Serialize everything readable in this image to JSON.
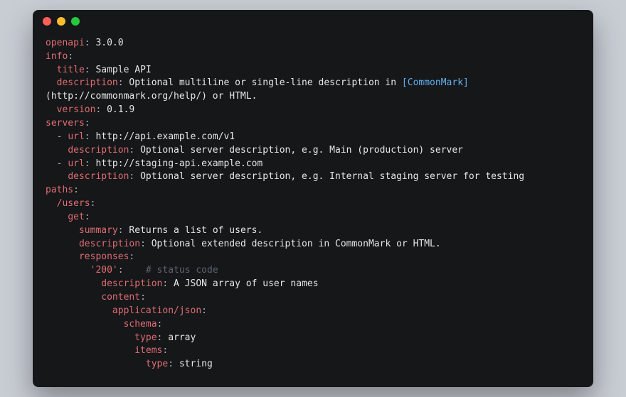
{
  "colors": {
    "bg_page": "#c8cdd4",
    "bg_window": "#151718",
    "key": "#e06c75",
    "value": "#e6e6e6",
    "link": "#61afef",
    "comment": "#5c6370",
    "dot_red": "#ff5f56",
    "dot_yellow": "#ffbd2e",
    "dot_green": "#27c93f"
  },
  "tokens": {
    "openapi_key": "openapi",
    "openapi_val": "3.0.0",
    "info_key": "info",
    "title_key": "title",
    "title_val": "Sample API",
    "description_key": "description",
    "info_desc_pre": "Optional multiline or single-line description in ",
    "info_desc_link": "[CommonMark]",
    "info_desc_post": "(http://commonmark.org/help/) or HTML.",
    "version_key": "version",
    "version_val": "0.1.9",
    "servers_key": "servers",
    "dash": "-",
    "url_key": "url",
    "server1_url": "http://api.example.com/v1",
    "server1_desc": "Optional server description, e.g. Main (production) server",
    "server2_url": "http://staging-api.example.com",
    "server2_desc": "Optional server description, e.g. Internal staging server for testing",
    "paths_key": "paths",
    "users_key": "/users",
    "get_key": "get",
    "summary_key": "summary",
    "summary_val": "Returns a list of users.",
    "get_desc_val": "Optional extended description in CommonMark or HTML.",
    "responses_key": "responses",
    "status_key": "'200'",
    "status_comment": "# status code",
    "resp_desc_val": "A JSON array of user names",
    "content_key": "content",
    "appjson_key": "application/json",
    "schema_key": "schema",
    "type_key": "type",
    "type_array": "array",
    "items_key": "items",
    "type_string": "string",
    "colon": ":",
    "colon_sp": ": "
  }
}
